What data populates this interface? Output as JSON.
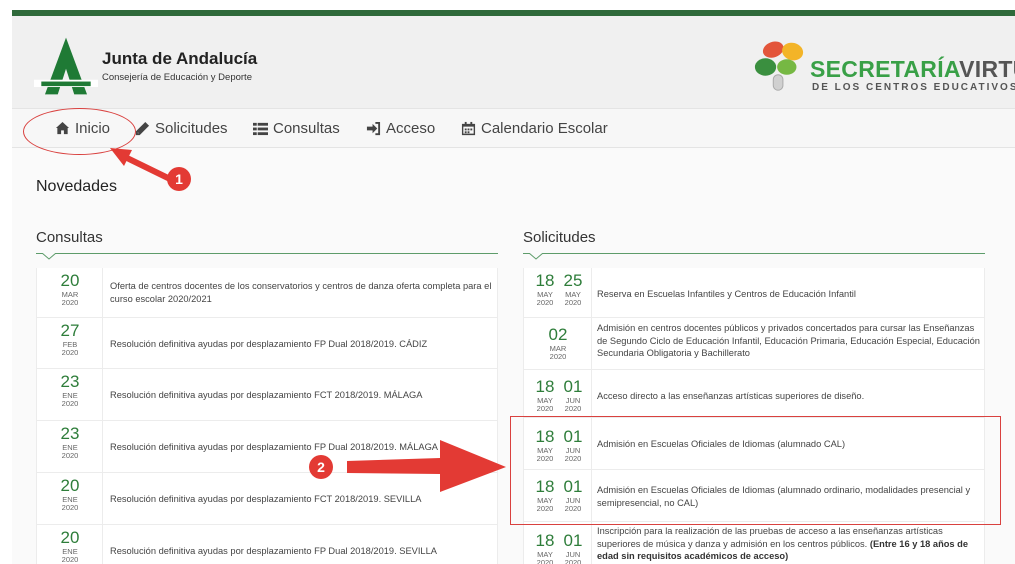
{
  "header": {
    "brand_title": "Junta de Andalucía",
    "brand_subtitle": "Consejería de Educación y Deporte",
    "sv_title_green": "SECRETARÍA",
    "sv_title_gray": "VIRTUAL",
    "sv_subtitle": "DE LOS CENTROS EDUCATIVOS"
  },
  "nav": {
    "items": [
      {
        "label": "Inicio",
        "icon": "home-icon"
      },
      {
        "label": "Solicitudes",
        "icon": "pencil-icon"
      },
      {
        "label": "Consultas",
        "icon": "list-icon"
      },
      {
        "label": "Acceso",
        "icon": "sign-in-icon"
      },
      {
        "label": "Calendario Escolar",
        "icon": "calendar-icon"
      }
    ]
  },
  "page": {
    "novedades": "Novedades"
  },
  "consultas": {
    "title": "Consultas",
    "rows": [
      {
        "day": "20",
        "mon": "MAR",
        "yr": "2020",
        "text": "Oferta de centros docentes de los conservatorios y centros de danza oferta completa para el curso escolar 2020/2021"
      },
      {
        "day": "27",
        "mon": "FEB",
        "yr": "2020",
        "text": "Resolución definitiva ayudas por desplazamiento FP Dual 2018/2019. CÁDIZ"
      },
      {
        "day": "23",
        "mon": "ENE",
        "yr": "2020",
        "text": "Resolución definitiva ayudas por desplazamiento FCT 2018/2019. MÁLAGA"
      },
      {
        "day": "23",
        "mon": "ENE",
        "yr": "2020",
        "text": "Resolución definitiva ayudas por desplazamiento FP Dual 2018/2019. MÁLAGA"
      },
      {
        "day": "20",
        "mon": "ENE",
        "yr": "2020",
        "text": "Resolución definitiva ayudas por desplazamiento FCT 2018/2019. SEVILLA"
      },
      {
        "day": "20",
        "mon": "ENE",
        "yr": "2020",
        "text": "Resolución definitiva ayudas por desplazamiento FP Dual 2018/2019. SEVILLA"
      }
    ]
  },
  "solicitudes": {
    "title": "Solicitudes",
    "rows": [
      {
        "d1": "18",
        "m1": "MAY",
        "y1": "2020",
        "d2": "25",
        "m2": "MAY",
        "y2": "2020",
        "text": "Reserva en Escuelas Infantiles y Centros de Educación Infantil",
        "bold": ""
      },
      {
        "d1": "02",
        "m1": "MAR",
        "y1": "2020",
        "d2": "",
        "m2": "",
        "y2": "",
        "text": "Admisión en centros docentes públicos y privados concertados para cursar las Enseñanzas de Segundo Ciclo de Educación Infantil, Educación Primaria, Educación Especial, Educación Secundaria Obligatoria y Bachillerato",
        "bold": ""
      },
      {
        "d1": "18",
        "m1": "MAY",
        "y1": "2020",
        "d2": "01",
        "m2": "JUN",
        "y2": "2020",
        "text": "Acceso directo a las enseñanzas artísticas superiores de diseño.",
        "bold": ""
      },
      {
        "d1": "18",
        "m1": "MAY",
        "y1": "2020",
        "d2": "01",
        "m2": "JUN",
        "y2": "2020",
        "text": "Admisión en Escuelas Oficiales de Idiomas (alumnado CAL)",
        "bold": ""
      },
      {
        "d1": "18",
        "m1": "MAY",
        "y1": "2020",
        "d2": "01",
        "m2": "JUN",
        "y2": "2020",
        "text": "Admisión en Escuelas Oficiales de Idiomas (alumnado ordinario, modalidades presencial y semipresencial, no CAL)",
        "bold": ""
      },
      {
        "d1": "18",
        "m1": "MAY",
        "y1": "2020",
        "d2": "01",
        "m2": "JUN",
        "y2": "2020",
        "text": "Inscripción para la realización de las pruebas de acceso a las enseñanzas artísticas superiores de música y danza y admisión en los centros públicos. ",
        "bold": "(Entre 16 y 18 años de edad sin requisitos académicos de acceso)"
      }
    ]
  },
  "annotations": {
    "badge1": "1",
    "badge2": "2"
  },
  "colors": {
    "accent_green": "#2e7d3a",
    "annotation_red": "#e33a34"
  }
}
